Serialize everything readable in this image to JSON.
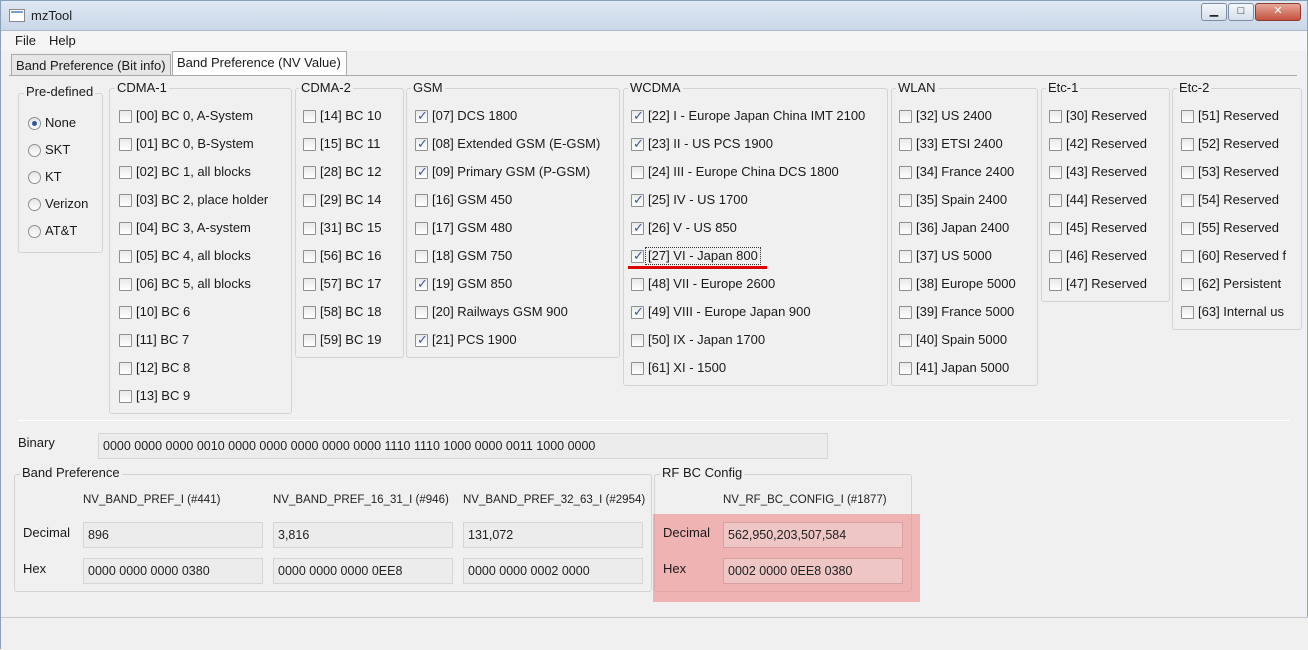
{
  "window": {
    "title": "mzTool"
  },
  "menu": {
    "file": "File",
    "help": "Help"
  },
  "tabs": [
    {
      "label": "Band Preference (Bit info)",
      "active": false
    },
    {
      "label": "Band Preference (NV Value)",
      "active": true
    }
  ],
  "predefined": {
    "title": "Pre-defined",
    "options": [
      "None",
      "SKT",
      "KT",
      "Verizon",
      "AT&T"
    ],
    "selected": "None"
  },
  "groups": {
    "cdma1": {
      "title": "CDMA-1",
      "items": [
        {
          "label": "[00] BC 0, A-System",
          "checked": false
        },
        {
          "label": "[01] BC 0, B-System",
          "checked": false
        },
        {
          "label": "[02] BC 1, all blocks",
          "checked": false
        },
        {
          "label": "[03] BC 2, place holder",
          "checked": false
        },
        {
          "label": "[04] BC 3, A-system",
          "checked": false
        },
        {
          "label": "[05] BC 4, all blocks",
          "checked": false
        },
        {
          "label": "[06] BC 5, all blocks",
          "checked": false
        },
        {
          "label": "[10] BC 6",
          "checked": false
        },
        {
          "label": "[11] BC 7",
          "checked": false
        },
        {
          "label": "[12] BC 8",
          "checked": false
        },
        {
          "label": "[13] BC 9",
          "checked": false
        }
      ]
    },
    "cdma2": {
      "title": "CDMA-2",
      "items": [
        {
          "label": "[14] BC 10",
          "checked": false
        },
        {
          "label": "[15] BC 11",
          "checked": false
        },
        {
          "label": "[28] BC 12",
          "checked": false
        },
        {
          "label": "[29] BC 14",
          "checked": false
        },
        {
          "label": "[31] BC 15",
          "checked": false
        },
        {
          "label": "[56] BC 16",
          "checked": false
        },
        {
          "label": "[57] BC 17",
          "checked": false
        },
        {
          "label": "[58] BC 18",
          "checked": false
        },
        {
          "label": "[59] BC 19",
          "checked": false
        }
      ]
    },
    "gsm": {
      "title": "GSM",
      "items": [
        {
          "label": "[07] DCS 1800",
          "checked": true
        },
        {
          "label": "[08] Extended GSM (E-GSM)",
          "checked": true
        },
        {
          "label": "[09] Primary GSM (P-GSM)",
          "checked": true
        },
        {
          "label": "[16] GSM 450",
          "checked": false
        },
        {
          "label": "[17] GSM 480",
          "checked": false
        },
        {
          "label": "[18] GSM 750",
          "checked": false
        },
        {
          "label": "[19] GSM 850",
          "checked": true
        },
        {
          "label": "[20] Railways GSM 900",
          "checked": false
        },
        {
          "label": "[21] PCS 1900",
          "checked": true
        }
      ]
    },
    "wcdma": {
      "title": "WCDMA",
      "items": [
        {
          "label": "[22] I - Europe Japan China IMT 2100",
          "checked": true
        },
        {
          "label": "[23] II - US PCS 1900",
          "checked": true
        },
        {
          "label": "[24] III - Europe China DCS 1800",
          "checked": false
        },
        {
          "label": "[25] IV - US 1700",
          "checked": true
        },
        {
          "label": "[26] V - US 850",
          "checked": true
        },
        {
          "label": "[27] VI - Japan 800",
          "checked": true
        },
        {
          "label": "[48] VII - Europe 2600",
          "checked": false
        },
        {
          "label": "[49] VIII - Europe Japan 900",
          "checked": true
        },
        {
          "label": "[50] IX - Japan 1700",
          "checked": false
        },
        {
          "label": "[61] XI - 1500",
          "checked": false
        }
      ]
    },
    "wlan": {
      "title": "WLAN",
      "items": [
        {
          "label": "[32] US 2400",
          "checked": false
        },
        {
          "label": "[33] ETSI 2400",
          "checked": false
        },
        {
          "label": "[34] France 2400",
          "checked": false
        },
        {
          "label": "[35] Spain 2400",
          "checked": false
        },
        {
          "label": "[36] Japan 2400",
          "checked": false
        },
        {
          "label": "[37] US 5000",
          "checked": false
        },
        {
          "label": "[38] Europe 5000",
          "checked": false
        },
        {
          "label": "[39] France 5000",
          "checked": false
        },
        {
          "label": "[40] Spain 5000",
          "checked": false
        },
        {
          "label": "[41] Japan 5000",
          "checked": false
        }
      ]
    },
    "etc1": {
      "title": "Etc-1",
      "items": [
        {
          "label": "[30] Reserved",
          "checked": false
        },
        {
          "label": "[42] Reserved",
          "checked": false
        },
        {
          "label": "[43] Reserved",
          "checked": false
        },
        {
          "label": "[44] Reserved",
          "checked": false
        },
        {
          "label": "[45] Reserved",
          "checked": false
        },
        {
          "label": "[46] Reserved",
          "checked": false
        },
        {
          "label": "[47] Reserved",
          "checked": false
        }
      ]
    },
    "etc2": {
      "title": "Etc-2",
      "items": [
        {
          "label": "[51] Reserved",
          "checked": false
        },
        {
          "label": "[52] Reserved",
          "checked": false
        },
        {
          "label": "[53] Reserved",
          "checked": false
        },
        {
          "label": "[54] Reserved",
          "checked": false
        },
        {
          "label": "[55] Reserved",
          "checked": false
        },
        {
          "label": "[60] Reserved f",
          "checked": false
        },
        {
          "label": "[62] Persistent",
          "checked": false
        },
        {
          "label": "[63] Internal us",
          "checked": false
        }
      ]
    }
  },
  "binary": {
    "label": "Binary",
    "value": "0000 0000 0000 0010 0000 0000 0000 0000 0000 1110 1110 1000 0000 0011 1000 0000"
  },
  "band_pref": {
    "title": "Band Preference",
    "decimal_label": "Decimal",
    "hex_label": "Hex",
    "columns": [
      {
        "header": "NV_BAND_PREF_I (#441)",
        "decimal": "896",
        "hex": "0000 0000 0000 0380"
      },
      {
        "header": "NV_BAND_PREF_16_31_I (#946)",
        "decimal": "3,816",
        "hex": "0000 0000 0000 0EE8"
      },
      {
        "header": "NV_BAND_PREF_32_63_I (#2954)",
        "decimal": "131,072",
        "hex": "0000 0000 0002 0000"
      }
    ]
  },
  "rf_bc_config": {
    "title": "RF BC Config",
    "header": "NV_RF_BC_CONFIG_I (#1877)",
    "decimal_label": "Decimal",
    "hex_label": "Hex",
    "decimal": "562,950,203,507,584",
    "hex": "0002 0000 0EE8 0380"
  },
  "colors": {
    "highlight": "#f08282",
    "underline": "#e00000",
    "check": "#3a5a96"
  }
}
